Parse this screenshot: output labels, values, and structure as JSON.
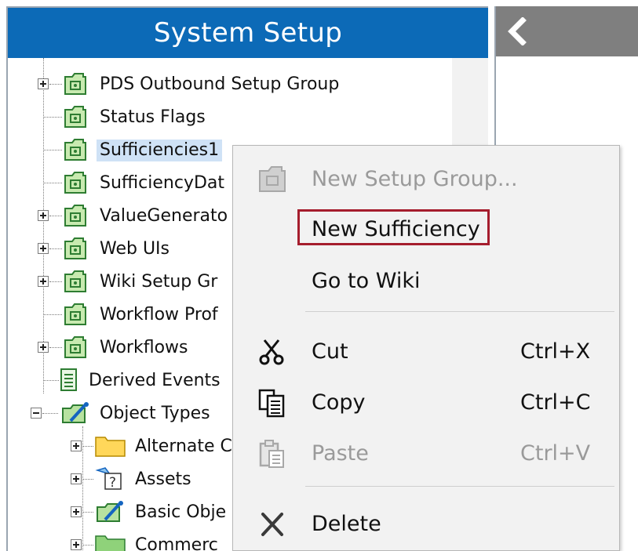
{
  "panel": {
    "title": "System Setup"
  },
  "tree": {
    "items": [
      {
        "label": "PDS Outbound Setup Group",
        "icon": "setup-group-icon"
      },
      {
        "label": "Status Flags",
        "icon": "setup-group-icon"
      },
      {
        "label": "Sufficiencies1",
        "icon": "setup-group-icon",
        "selected": true
      },
      {
        "label": "SufficiencyDat",
        "icon": "setup-group-icon"
      },
      {
        "label": "ValueGenerato",
        "icon": "setup-group-icon"
      },
      {
        "label": "Web UIs",
        "icon": "setup-group-icon"
      },
      {
        "label": "Wiki Setup Gr",
        "icon": "setup-group-icon"
      },
      {
        "label": "Workflow Prof",
        "icon": "setup-group-icon"
      },
      {
        "label": "Workflows",
        "icon": "setup-group-icon"
      },
      {
        "label": "Derived Events",
        "icon": "document-list-icon"
      },
      {
        "label": "Object Types",
        "icon": "object-types-icon"
      },
      {
        "label": "Alternate C",
        "icon": "folder-icon"
      },
      {
        "label": "Assets",
        "icon": "assets-icon"
      },
      {
        "label": "Basic Obje",
        "icon": "object-types-icon"
      },
      {
        "label": "Commerc",
        "icon": "green-folder-icon"
      }
    ]
  },
  "context_menu": {
    "items": [
      {
        "label": "New Setup Group...",
        "shortcut": "",
        "icon": "setup-group-icon",
        "disabled": true
      },
      {
        "label": "New Sufficiency",
        "shortcut": "",
        "icon": "",
        "disabled": false,
        "highlighted": true
      },
      {
        "label": "Go to Wiki",
        "shortcut": "",
        "icon": "",
        "disabled": false
      },
      {
        "label": "Cut",
        "shortcut": "Ctrl+X",
        "icon": "scissors-icon",
        "disabled": false
      },
      {
        "label": "Copy",
        "shortcut": "Ctrl+C",
        "icon": "copy-icon",
        "disabled": false
      },
      {
        "label": "Paste",
        "shortcut": "Ctrl+V",
        "icon": "paste-icon",
        "disabled": true
      },
      {
        "label": "Delete",
        "shortcut": "",
        "icon": "delete-icon",
        "disabled": false
      }
    ]
  },
  "colors": {
    "header_blue": "#0c6ab7",
    "highlight_red": "#a51d2d",
    "selection_blue": "#cfe2f6"
  }
}
